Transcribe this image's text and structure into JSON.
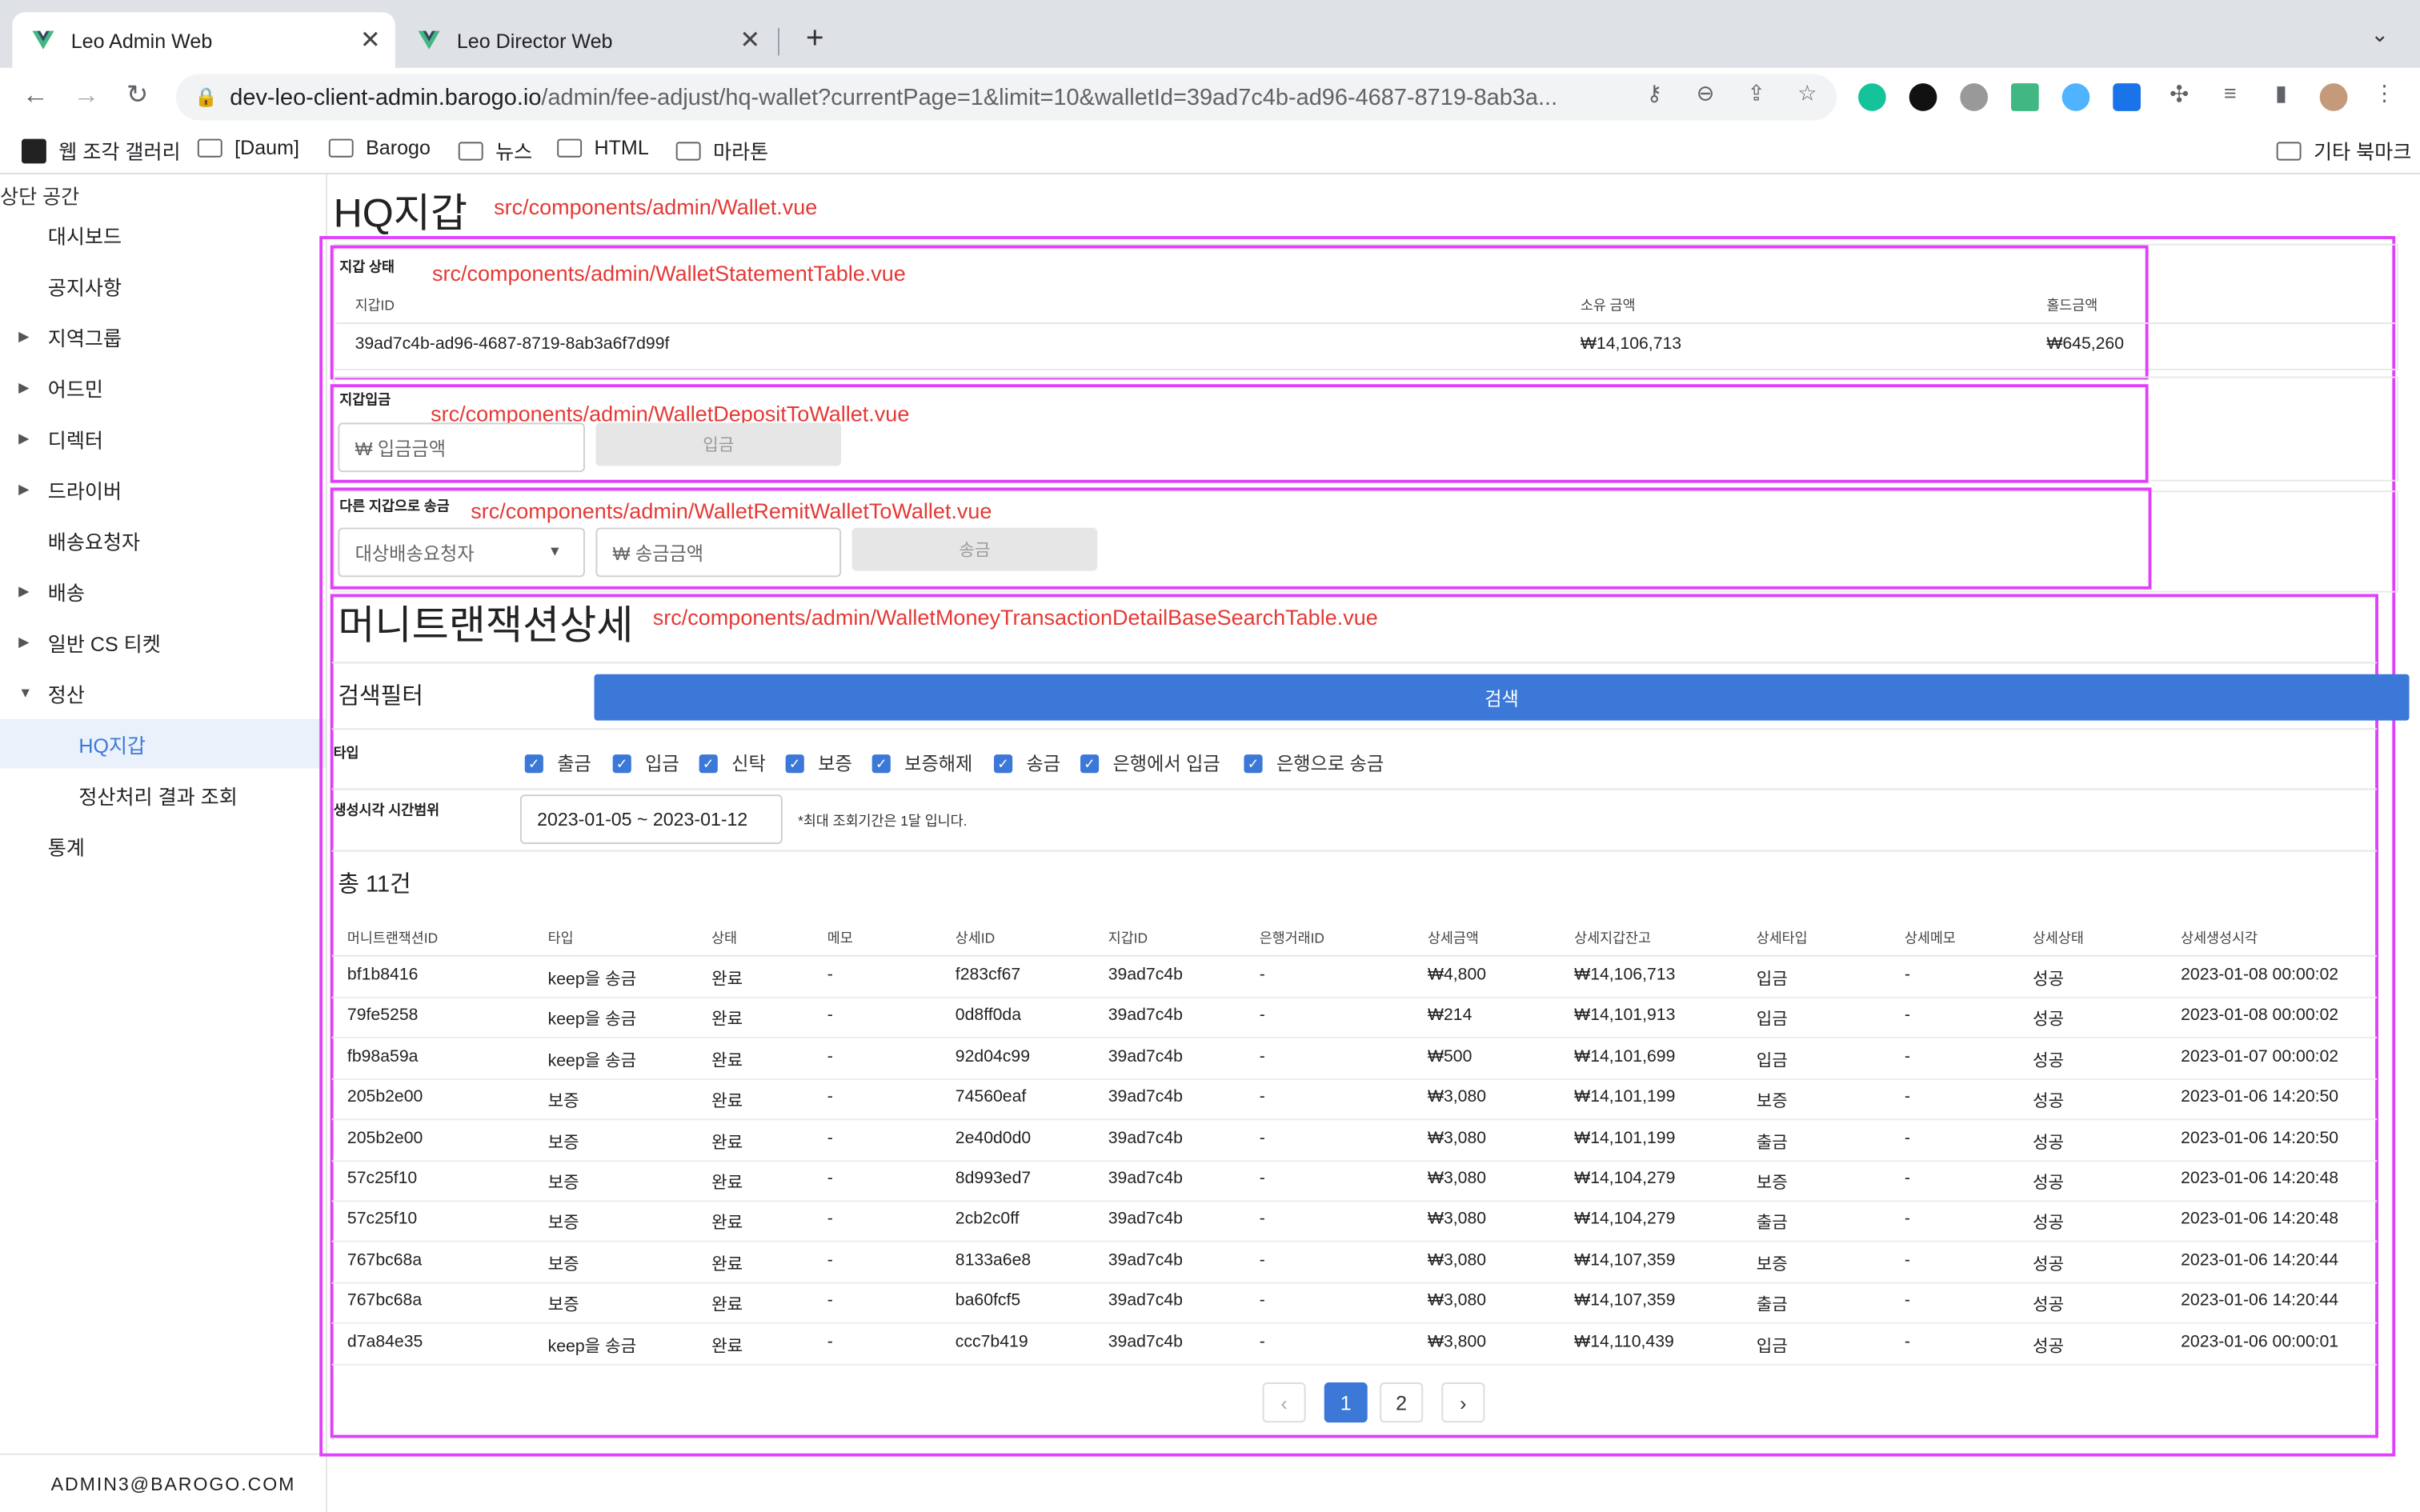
{
  "browser": {
    "tabs": [
      {
        "title": "Leo Admin Web"
      },
      {
        "title": "Leo Director Web"
      }
    ],
    "url_host": "dev-leo-client-admin.barogo.io",
    "url_path": "/admin/fee-adjust/hq-wallet?currentPage=1&limit=10&walletId=39ad7c4b-ad96-4687-8719-8ab3a...",
    "bookmarks": [
      "웹 조각 갤러리",
      "[Daum]",
      "Barogo",
      "뉴스",
      "HTML",
      "마라톤"
    ],
    "other_bookmarks": "기타 북마크"
  },
  "sidebar": {
    "header": "상단 공간",
    "items": [
      {
        "label": "대시보드",
        "arrow": ""
      },
      {
        "label": "공지사항",
        "arrow": ""
      },
      {
        "label": "지역그룹",
        "arrow": "▶"
      },
      {
        "label": "어드민",
        "arrow": "▶"
      },
      {
        "label": "디렉터",
        "arrow": "▶"
      },
      {
        "label": "드라이버",
        "arrow": "▶"
      },
      {
        "label": "배송요청자",
        "arrow": ""
      },
      {
        "label": "배송",
        "arrow": "▶"
      },
      {
        "label": "일반 CS 티켓",
        "arrow": "▶"
      },
      {
        "label": "정산",
        "arrow": "▼"
      },
      {
        "label": "HQ지갑",
        "arrow": ""
      },
      {
        "label": "정산처리 결과 조회",
        "arrow": ""
      },
      {
        "label": "통계",
        "arrow": ""
      }
    ],
    "footer": "ADMIN3@BAROGO.COM"
  },
  "page": {
    "title": "HQ지갑",
    "title_path": "src/components/admin/Wallet.vue"
  },
  "wallet_statement": {
    "title": "지갑 상태",
    "path": "src/components/admin/WalletStatementTable.vue",
    "headers": [
      "지갑ID",
      "소유 금액",
      "홀드금액"
    ],
    "wallet_id": "39ad7c4b-ad96-4687-8719-8ab3a6f7d99f",
    "owned_amount": "₩14,106,713",
    "hold_amount": "₩645,260"
  },
  "deposit": {
    "title": "지갑입금",
    "path": "src/components/admin/WalletDepositToWallet.vue",
    "placeholder": "₩ 입금금액",
    "button": "입금"
  },
  "remit": {
    "title": "다른 지갑으로 송금",
    "path": "src/components/admin/WalletRemitWalletToWallet.vue",
    "select_placeholder": "대상배송요청자",
    "amount_placeholder": "₩ 송금금액",
    "button": "송금"
  },
  "transactions": {
    "title": "머니트랜잭션상세",
    "path": "src/components/admin/WalletMoneyTransactionDetailBaseSearchTable.vue",
    "filter_label": "검색필터",
    "search_button": "검색",
    "type_label": "타입",
    "types": [
      "출금",
      "입금",
      "신탁",
      "보증",
      "보증해제",
      "송금",
      "은행에서 입금",
      "은행으로 송금"
    ],
    "date_label": "생성시각 시간범위",
    "date_range": "2023-01-05 ~ 2023-01-12",
    "date_note": "*최대 조회기간은 1달 입니다.",
    "total": "총 11건",
    "columns": [
      "머니트랜잭션ID",
      "타입",
      "상태",
      "메모",
      "상세ID",
      "지갑ID",
      "은행거래ID",
      "상세금액",
      "상세지갑잔고",
      "상세타입",
      "상세메모",
      "상세상태",
      "상세생성시각"
    ],
    "rows": [
      [
        "bf1b8416",
        "keep을 송금",
        "완료",
        "-",
        "f283cf67",
        "39ad7c4b",
        "-",
        "₩4,800",
        "₩14,106,713",
        "입금",
        "-",
        "성공",
        "2023-01-08 00:00:02"
      ],
      [
        "79fe5258",
        "keep을 송금",
        "완료",
        "-",
        "0d8ff0da",
        "39ad7c4b",
        "-",
        "₩214",
        "₩14,101,913",
        "입금",
        "-",
        "성공",
        "2023-01-08 00:00:02"
      ],
      [
        "fb98a59a",
        "keep을 송금",
        "완료",
        "-",
        "92d04c99",
        "39ad7c4b",
        "-",
        "₩500",
        "₩14,101,699",
        "입금",
        "-",
        "성공",
        "2023-01-07 00:00:02"
      ],
      [
        "205b2e00",
        "보증",
        "완료",
        "-",
        "74560eaf",
        "39ad7c4b",
        "-",
        "₩3,080",
        "₩14,101,199",
        "보증",
        "-",
        "성공",
        "2023-01-06 14:20:50"
      ],
      [
        "205b2e00",
        "보증",
        "완료",
        "-",
        "2e40d0d0",
        "39ad7c4b",
        "-",
        "₩3,080",
        "₩14,101,199",
        "출금",
        "-",
        "성공",
        "2023-01-06 14:20:50"
      ],
      [
        "57c25f10",
        "보증",
        "완료",
        "-",
        "8d993ed7",
        "39ad7c4b",
        "-",
        "₩3,080",
        "₩14,104,279",
        "보증",
        "-",
        "성공",
        "2023-01-06 14:20:48"
      ],
      [
        "57c25f10",
        "보증",
        "완료",
        "-",
        "2cb2c0ff",
        "39ad7c4b",
        "-",
        "₩3,080",
        "₩14,104,279",
        "출금",
        "-",
        "성공",
        "2023-01-06 14:20:48"
      ],
      [
        "767bc68a",
        "보증",
        "완료",
        "-",
        "8133a6e8",
        "39ad7c4b",
        "-",
        "₩3,080",
        "₩14,107,359",
        "보증",
        "-",
        "성공",
        "2023-01-06 14:20:44"
      ],
      [
        "767bc68a",
        "보증",
        "완료",
        "-",
        "ba60fcf5",
        "39ad7c4b",
        "-",
        "₩3,080",
        "₩14,107,359",
        "출금",
        "-",
        "성공",
        "2023-01-06 14:20:44"
      ],
      [
        "d7a84e35",
        "keep을 송금",
        "완료",
        "-",
        "ccc7b419",
        "39ad7c4b",
        "-",
        "₩3,800",
        "₩14,110,439",
        "입금",
        "-",
        "성공",
        "2023-01-06 00:00:01"
      ]
    ],
    "pages": [
      "1",
      "2"
    ],
    "current_page": "1",
    "prev_label": "‹",
    "next_label": "›"
  }
}
